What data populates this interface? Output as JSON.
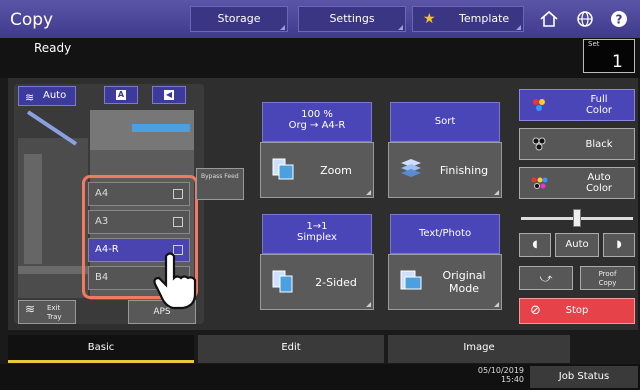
{
  "app": {
    "title": "Copy",
    "status": "Ready"
  },
  "top_tabs": [
    {
      "label": "Storage"
    },
    {
      "label": "Settings"
    },
    {
      "label": "Template"
    }
  ],
  "set": {
    "label": "Set",
    "value": "1"
  },
  "machine": {
    "auto_label": "Auto",
    "trays": [
      {
        "label": "A4",
        "selected": false
      },
      {
        "label": "A3",
        "selected": false
      },
      {
        "label": "A4-R",
        "selected": true
      },
      {
        "label": "B4",
        "selected": false
      }
    ],
    "bypass_label": "Bypass Feed",
    "exit_tray_label": "Exit Tray",
    "aps_label": "APS"
  },
  "functions": {
    "zoom": {
      "top_line1": "100 %",
      "top_line2": "Org  →  A4-R",
      "label": "Zoom"
    },
    "sort": {
      "top_label": "Sort",
      "label": "Finishing"
    },
    "duplex": {
      "top_line1": "1→1",
      "top_line2": "Simplex",
      "label": "2-Sided"
    },
    "mode": {
      "top_label": "Text/Photo",
      "label_line1": "Original",
      "label_line2": "Mode"
    }
  },
  "color": {
    "full": {
      "line1": "Full",
      "line2": "Color"
    },
    "black": "Black",
    "auto": {
      "line1": "Auto",
      "line2": "Color"
    }
  },
  "density": {
    "auto_label": "Auto",
    "level_fraction": 0.5
  },
  "proof_copy": {
    "line1": "Proof",
    "line2": "Copy"
  },
  "stop_label": "Stop",
  "bottom_tabs": [
    {
      "label": "Basic",
      "active": true
    },
    {
      "label": "Edit",
      "active": false
    },
    {
      "label": "Image",
      "active": false
    }
  ],
  "datetime": {
    "date": "05/10/2019",
    "time": "15:40"
  },
  "job_status_label": "Job Status",
  "colors": {
    "accent": "#4b46b8",
    "stop": "#e6424a",
    "highlight": "#f27a60",
    "active_tab": "#e8c83a"
  }
}
